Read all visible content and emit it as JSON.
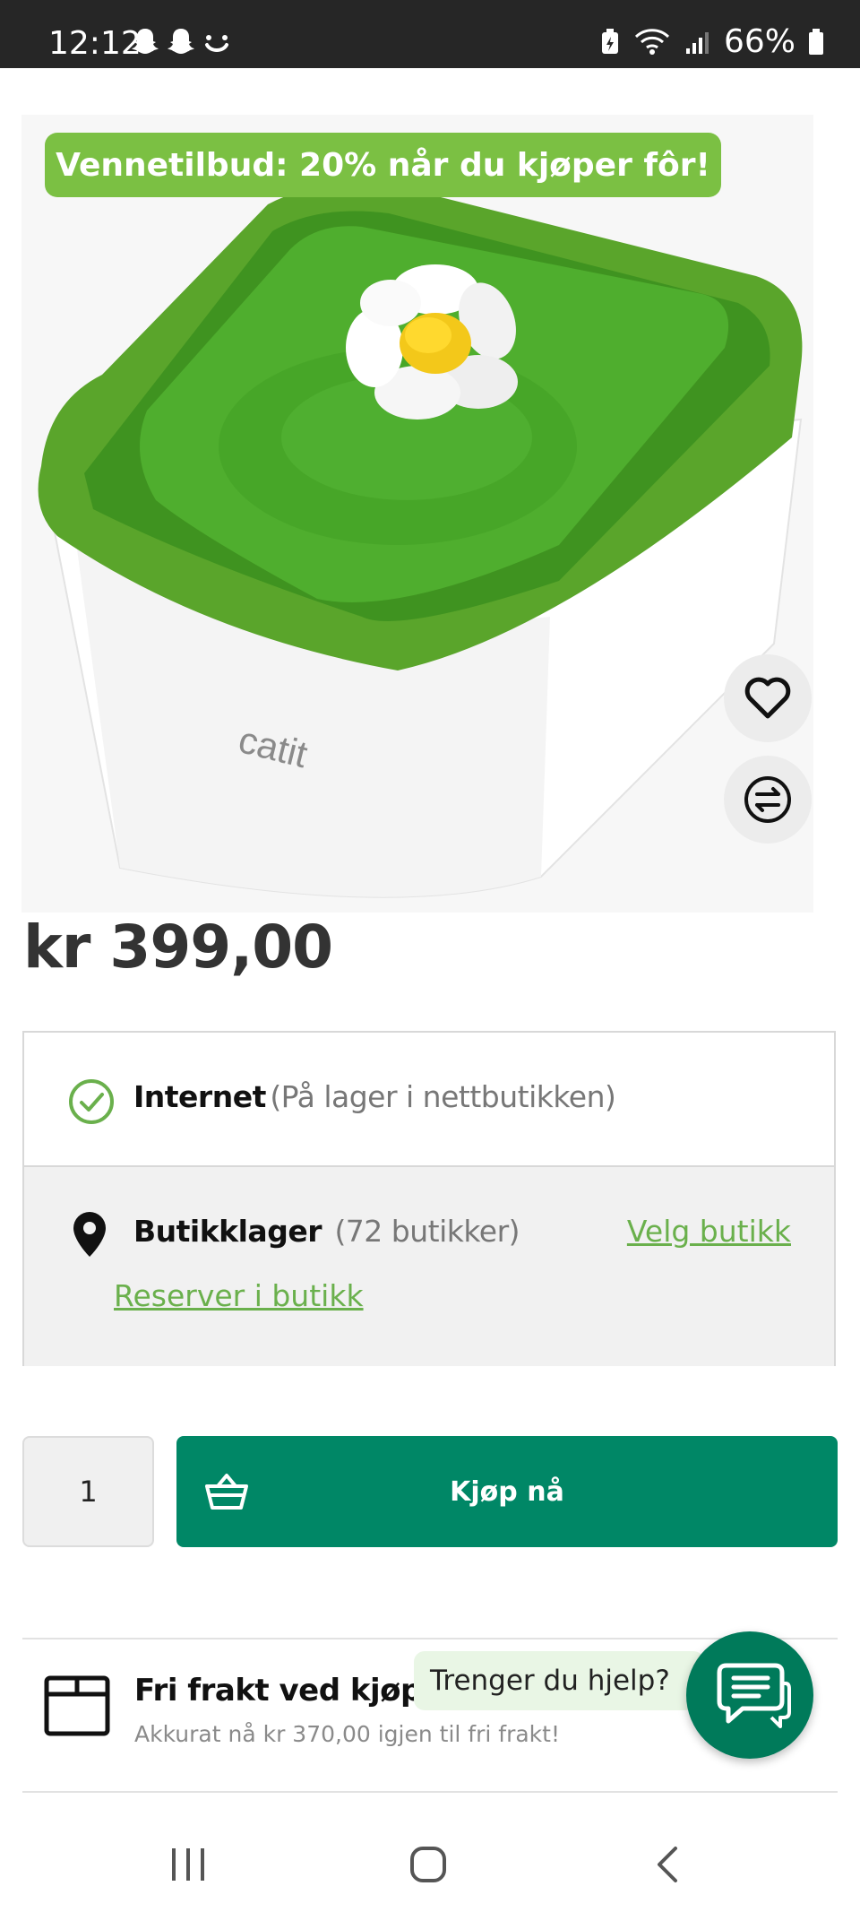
{
  "status_bar": {
    "time": "12:12",
    "battery": "66%",
    "notification_icons": [
      "snapchat-icon",
      "snapchat-icon",
      "face-icon"
    ]
  },
  "product": {
    "promo": "Vennetilbud: 20% når du kjøper fôr!",
    "brand_mark": "catit",
    "price": "kr 399,00"
  },
  "stock": {
    "internet_label": "Internet",
    "internet_status": "(På lager i nettbutikken)",
    "store_label": "Butikklager",
    "store_count": "(72 butikker)",
    "choose_store": "Velg butikk",
    "reserve": "Reserver i butikk"
  },
  "purchase": {
    "quantity": "1",
    "buy_label": "Kjøp nå"
  },
  "shipping": {
    "title": "Fri frakt ved kjøp ov",
    "subtitle": "Akkurat nå kr 370,00 igjen til fri frakt!"
  },
  "chat": {
    "help_text": "Trenger du hjelp?"
  },
  "colors": {
    "brand_green": "#7bc043",
    "buy_green": "#008766",
    "link_green": "#6ab04c"
  }
}
